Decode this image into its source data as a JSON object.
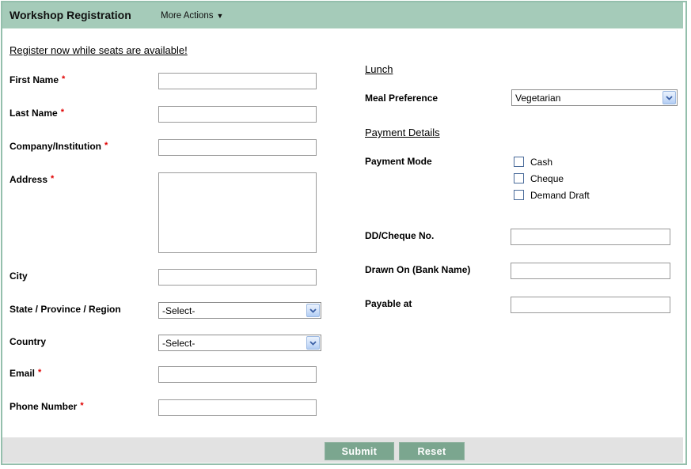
{
  "colors": {
    "header_bg": "#a5cbb9",
    "page_border": "#94bfac",
    "footer_bg": "#e2e2e2",
    "button_bg": "#7ba68f",
    "button_text": "#ffffff",
    "required_asterisk": "#e00000",
    "input_border": "#9a9a9a",
    "checkbox_border": "#4a6b9a"
  },
  "header": {
    "title": "Workshop Registration",
    "more_actions_label": "More Actions",
    "caret": "▼"
  },
  "intro": "Register now while seats are available!",
  "left_column": {
    "fields": [
      {
        "label": "First Name",
        "required": "*",
        "value": "",
        "type": "text"
      },
      {
        "label": "Last Name",
        "required": "*",
        "value": "",
        "type": "text"
      },
      {
        "label": "Company/Institution",
        "required": "*",
        "value": "",
        "type": "text"
      },
      {
        "label": "Address",
        "required": "*",
        "value": "",
        "type": "textarea"
      },
      {
        "label": "City",
        "value": "",
        "type": "text"
      },
      {
        "label": "State / Province / Region",
        "value": "-Select-",
        "type": "select"
      },
      {
        "label": "Country",
        "value": "-Select-",
        "type": "select"
      },
      {
        "label": "Email",
        "required": "*",
        "value": "",
        "type": "text"
      },
      {
        "label": "Phone Number",
        "required": "*",
        "value": "",
        "type": "text"
      }
    ]
  },
  "right_column": {
    "lunch_section_title": "Payment Details",
    "sections": {
      "lunch": "Lunch",
      "payment": "Payment Details"
    },
    "meal_preference": {
      "label": "Meal Preference",
      "value": "Vegetarian",
      "type": "select"
    },
    "payment_mode": {
      "label": "Payment Mode",
      "options": [
        {
          "label": "Cash",
          "checked": false
        },
        {
          "label": "Cheque",
          "checked": false
        },
        {
          "label": "Demand Draft",
          "checked": false
        }
      ]
    },
    "dd_cheque_no": {
      "label": "DD/Cheque No.",
      "value": "",
      "type": "text"
    },
    "drawn_on": {
      "label": "Drawn On (Bank Name)",
      "value": "",
      "type": "text"
    },
    "payable_at": {
      "label": "Payable at",
      "value": "",
      "type": "text"
    }
  },
  "footer": {
    "submit_label": "Submit",
    "reset_label": "Reset"
  }
}
